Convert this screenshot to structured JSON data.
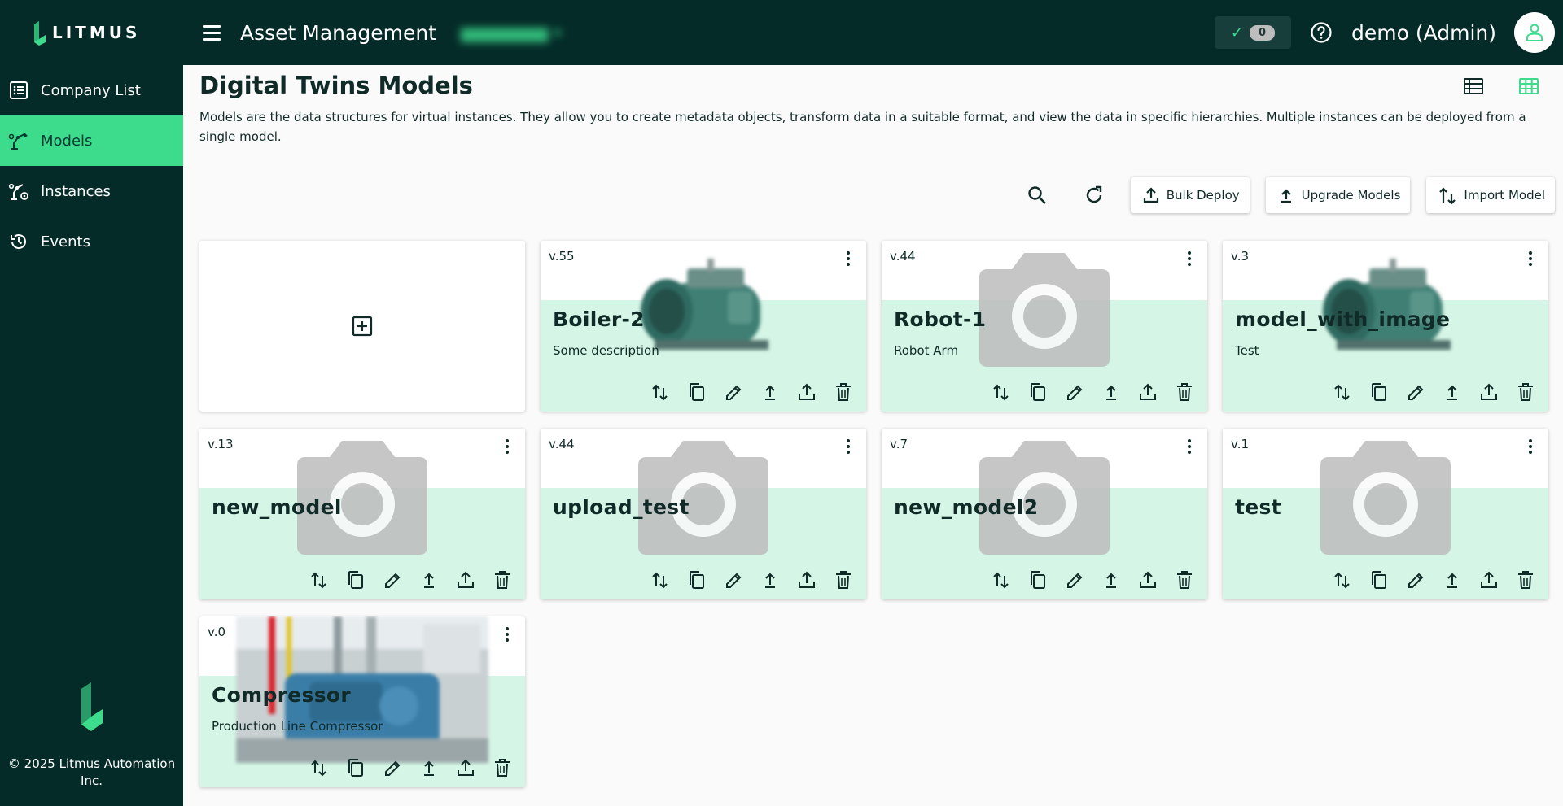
{
  "brand": {
    "name": "LITMUS",
    "accent": "#3ddc8c",
    "dark": "#042b28"
  },
  "sidebar": {
    "items": [
      {
        "label": "Company List",
        "icon": "list-icon",
        "active": false
      },
      {
        "label": "Models",
        "icon": "model-icon",
        "active": true
      },
      {
        "label": "Instances",
        "icon": "instances-icon",
        "active": false
      },
      {
        "label": "Events",
        "icon": "history-icon",
        "active": false
      }
    ],
    "copyright": "© 2025 Litmus Automation Inc."
  },
  "header": {
    "title": "Asset Management",
    "status_count": "0",
    "user": "demo (Admin)"
  },
  "page": {
    "title": "Digital Twins Models",
    "description": "Models are the data structures for virtual instances. They allow you to create metadata objects, transform data in a suitable format, and view the data in specific hierarchies. Multiple instances can be deployed from a single model."
  },
  "toolbar": {
    "bulk_deploy": "Bulk Deploy",
    "upgrade_models": "Upgrade Models",
    "import_model": "Import Model"
  },
  "cards": [
    {
      "version": "v.55",
      "name": "Boiler-2",
      "description": "Some description",
      "image": "boiler"
    },
    {
      "version": "v.44",
      "name": "Robot-1",
      "description": "Robot Arm",
      "image": "placeholder"
    },
    {
      "version": "v.3",
      "name": "model_with_image",
      "description": "Test",
      "image": "boiler"
    },
    {
      "version": "v.13",
      "name": "new_model",
      "description": "",
      "image": "placeholder"
    },
    {
      "version": "v.44",
      "name": "upload_test",
      "description": "",
      "image": "placeholder"
    },
    {
      "version": "v.7",
      "name": "new_model2",
      "description": "",
      "image": "placeholder"
    },
    {
      "version": "v.1",
      "name": "test",
      "description": "",
      "image": "placeholder"
    },
    {
      "version": "v.0",
      "name": "Compressor",
      "description": "Production Line Compressor",
      "image": "factory"
    }
  ]
}
